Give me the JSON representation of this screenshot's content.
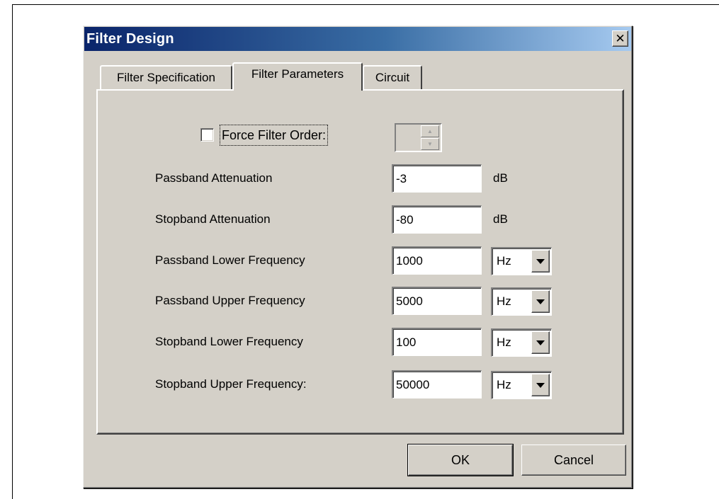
{
  "dialog": {
    "title": "Filter Design",
    "close_glyph": "✕"
  },
  "tabs": [
    {
      "label": "Filter Specification",
      "active": false
    },
    {
      "label": "Filter Parameters",
      "active": true
    },
    {
      "label": "Circuit",
      "active": false
    }
  ],
  "force_order": {
    "label": "Force Filter Order:",
    "checked": false,
    "spinner_up": "▲",
    "spinner_down": "▼"
  },
  "params": [
    {
      "label": "Passband Attenuation",
      "value": "-3",
      "unit": "dB",
      "unit_type": "static"
    },
    {
      "label": "Stopband Attenuation",
      "value": "-80",
      "unit": "dB",
      "unit_type": "static"
    },
    {
      "label": "Passband Lower Frequency",
      "value": "1000",
      "unit": "Hz",
      "unit_type": "dropdown"
    },
    {
      "label": "Passband Upper Frequency",
      "value": "5000",
      "unit": "Hz",
      "unit_type": "dropdown"
    },
    {
      "label": "Stopband Lower Frequency",
      "value": "100",
      "unit": "Hz",
      "unit_type": "dropdown"
    },
    {
      "label": "Stopband Upper Frequency:",
      "value": "50000",
      "unit": "Hz",
      "unit_type": "dropdown"
    }
  ],
  "buttons": {
    "ok": "OK",
    "cancel": "Cancel"
  }
}
